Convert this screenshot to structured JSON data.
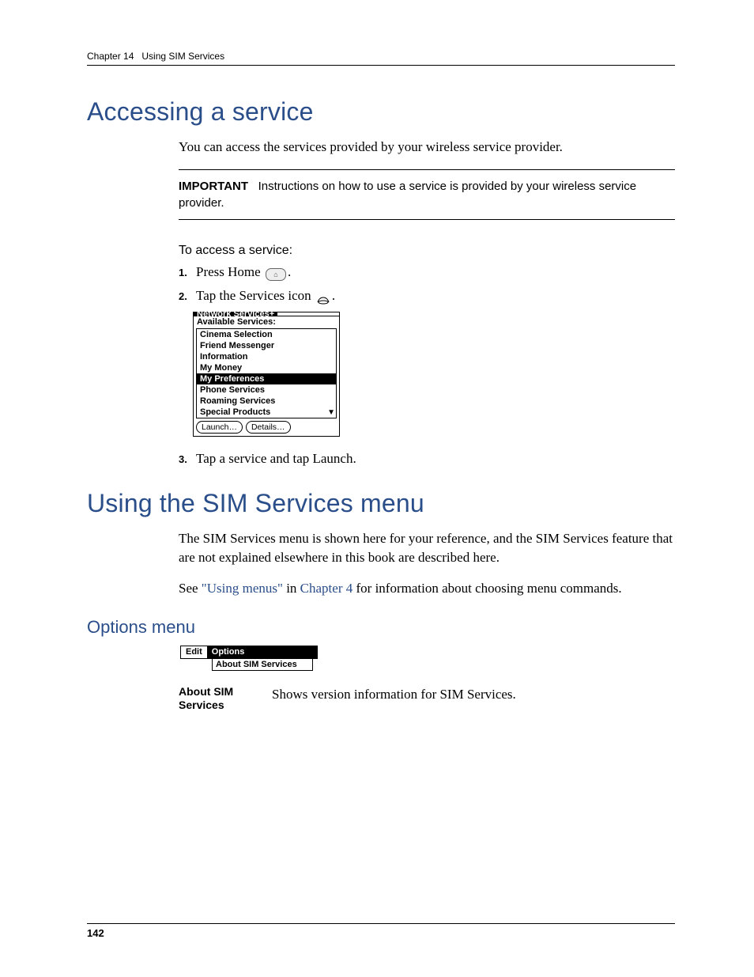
{
  "header": {
    "chapter": "Chapter 14",
    "title": "Using SIM Services"
  },
  "section1": {
    "heading": "Accessing a service",
    "intro": "You can access the services provided by your wireless service provider.",
    "important_label": "IMPORTANT",
    "important_text": "Instructions on how to use a service is provided by your wireless service provider.",
    "procedure_heading": "To access a service:",
    "steps": {
      "s1_num": "1.",
      "s1_a": "Press Home ",
      "s1_b": ".",
      "s2_num": "2.",
      "s2_a": "Tap the Services icon ",
      "s2_b": ".",
      "s3_num": "3.",
      "s3": "Tap a service and tap Launch."
    }
  },
  "palm": {
    "title": "Network Services+",
    "subtitle": "Available Services:",
    "items": [
      "Cinema Selection",
      "Friend Messenger",
      "Information",
      "My Money",
      "My Preferences",
      "Phone Services",
      "Roaming Services",
      "Special Products"
    ],
    "selected_index": 4,
    "btn_launch": "Launch…",
    "btn_details": "Details…"
  },
  "section2": {
    "heading": "Using the SIM Services menu",
    "para1": "The SIM Services menu is shown here for your reference, and the SIM Services feature that are not explained elsewhere in this book are described here.",
    "para2_a": "See ",
    "para2_link1": "\"Using menus\"",
    "para2_b": " in ",
    "para2_link2": "Chapter 4",
    "para2_c": " for information about choosing menu commands.",
    "subhead": "Options menu",
    "menu": {
      "edit": "Edit",
      "options": "Options",
      "about": "About SIM Services"
    },
    "def_term": "About SIM Services",
    "def_desc": "Shows version information for SIM Services."
  },
  "page_number": "142"
}
